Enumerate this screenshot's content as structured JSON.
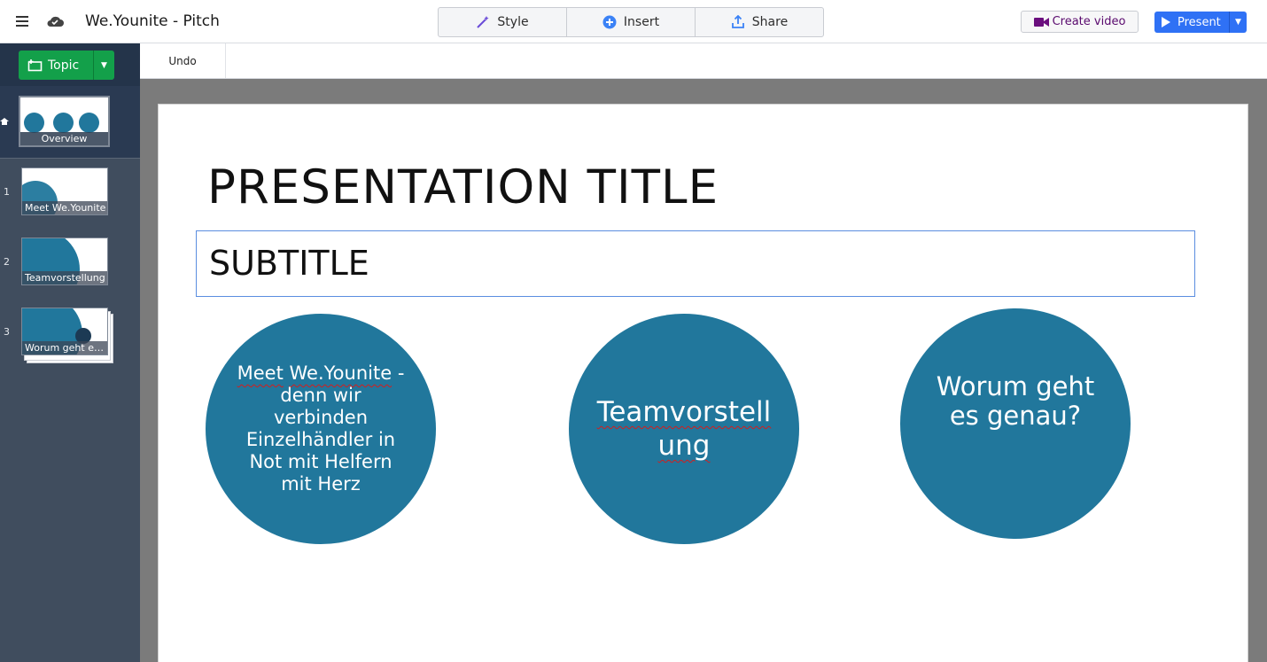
{
  "app": {
    "title": "We.Younite - Pitch"
  },
  "toolbar": {
    "style_label": "Style",
    "insert_label": "Insert",
    "share_label": "Share",
    "create_video_label": "Create video",
    "present_label": "Present",
    "undo_label": "Undo"
  },
  "sidebar": {
    "topic_label": "Topic",
    "overview_label": "Overview",
    "slides": [
      {
        "number": "1",
        "label": "Meet We.Younite"
      },
      {
        "number": "2",
        "label": "Teamvorstellung"
      },
      {
        "number": "3",
        "label": "Worum geht es genau?"
      }
    ]
  },
  "slide": {
    "title": "PRESENTATION TITLE",
    "subtitle": "SUBTITLE",
    "circles": [
      {
        "text_a": "Meet",
        "text_b": "We.Younite",
        "text_rest": "- denn wir verbinden Einzelhändler in Not mit Helfern mit Herz"
      },
      {
        "text": "Teamvorstellung"
      },
      {
        "text": "Worum geht es genau?"
      }
    ]
  },
  "colors": {
    "accent": "#2f71f5",
    "topic": "#13a04a",
    "circle": "#21779c",
    "sidebar": "#404d5e",
    "video": "#5a0a6e"
  }
}
